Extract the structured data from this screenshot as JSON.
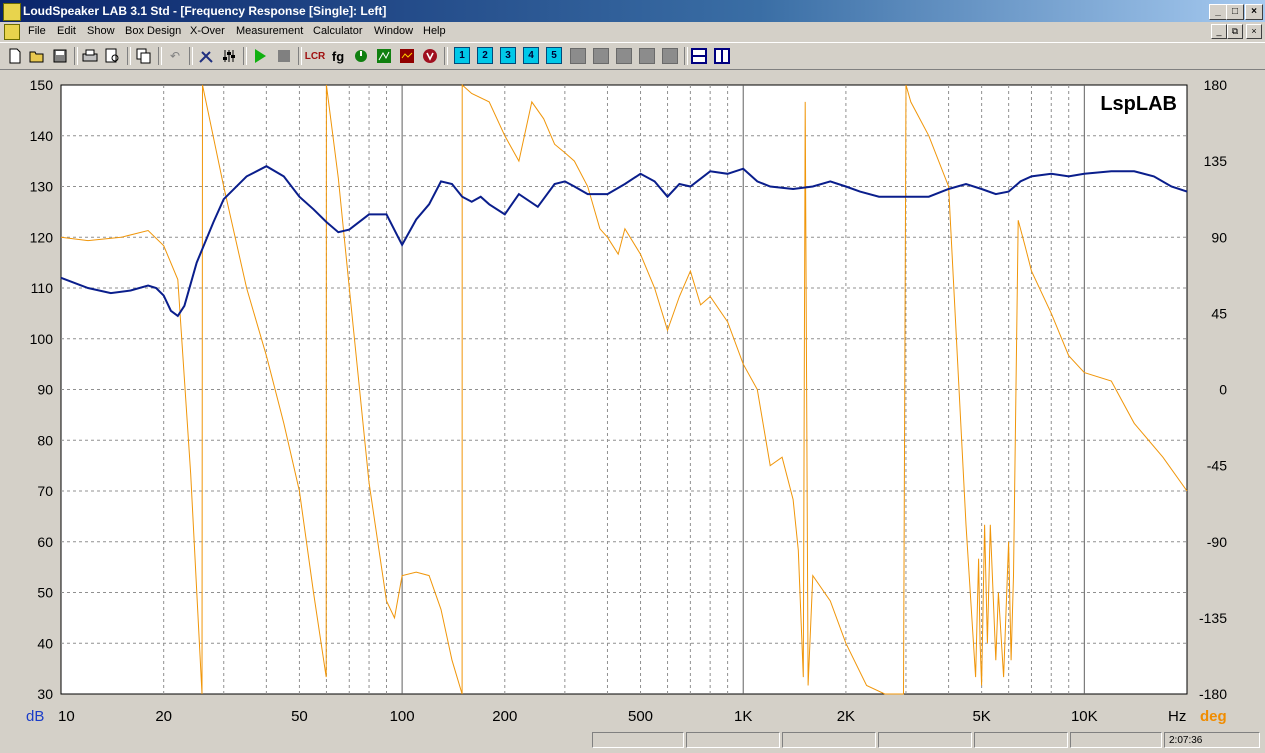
{
  "window": {
    "title": "LoudSpeaker LAB 3.1 Std - [Frequency Response [Single]: Left]",
    "controls": [
      "_",
      "□",
      "×"
    ],
    "mdi_controls": [
      "_",
      "⧉",
      "×"
    ]
  },
  "menu": [
    "File",
    "Edit",
    "Show",
    "Box Design",
    "X-Over",
    "Measurement",
    "Calculator",
    "Window",
    "Help"
  ],
  "toolbar": {
    "numbered_buttons": [
      "1",
      "2",
      "3",
      "4",
      "5"
    ],
    "icons": [
      "new-icon",
      "open-icon",
      "save-icon",
      "print-icon",
      "print-preview-icon",
      "copy-icon",
      "undo-icon",
      "tools-icon",
      "sliders-icon",
      "play-icon",
      "stop-icon",
      "lcr-icon",
      "fg-icon",
      "gauge-icon",
      "chart-icon",
      "waterfall-icon",
      "v-icon",
      "split-h-icon",
      "split-v-icon"
    ],
    "lcr_label": "LCR",
    "fg_label": "fg"
  },
  "chart_data": {
    "type": "line",
    "watermark": "LspLAB",
    "xscale": "log",
    "xlim": [
      10,
      20000
    ],
    "x_ticks": [
      10,
      20,
      50,
      100,
      200,
      500,
      1000,
      2000,
      5000,
      10000
    ],
    "x_tick_labels": [
      "10",
      "20",
      "50",
      "100",
      "200",
      "500",
      "1K",
      "2K",
      "5K",
      "10K"
    ],
    "x_unit": "Hz",
    "y_left": {
      "unit": "dB",
      "lim": [
        30,
        150
      ],
      "ticks": [
        30,
        40,
        50,
        60,
        70,
        80,
        90,
        100,
        110,
        120,
        130,
        140,
        150
      ]
    },
    "y_right": {
      "unit": "deg",
      "lim": [
        -180,
        180
      ],
      "ticks": [
        180,
        135,
        90,
        45,
        0,
        -45,
        -90,
        -135,
        -180
      ]
    },
    "grid": true,
    "colors": {
      "magnitude": "#0a1e8c",
      "phase": "#f0960a",
      "left_unit": "#1a3cc8",
      "right_unit": "#f08c00"
    },
    "series": [
      {
        "axis": "left",
        "x": [
          10,
          12,
          14,
          16,
          18,
          19,
          20,
          21,
          22,
          23,
          25,
          28,
          30,
          35,
          40,
          45,
          50,
          55,
          60,
          65,
          70,
          80,
          90,
          100,
          110,
          120,
          130,
          140,
          150,
          160,
          170,
          180,
          200,
          220,
          250,
          280,
          300,
          320,
          350,
          400,
          450,
          500,
          550,
          600,
          650,
          700,
          800,
          900,
          1000,
          1100,
          1200,
          1400,
          1600,
          1800,
          2000,
          2200,
          2500,
          3000,
          3500,
          4000,
          4500,
          5000,
          5500,
          6000,
          6500,
          7000,
          8000,
          9000,
          10000,
          12000,
          14000,
          16000,
          18000,
          20000
        ],
        "values": [
          112,
          110,
          109,
          109.5,
          110.5,
          110,
          108.5,
          105.5,
          104.5,
          106.5,
          115,
          123,
          127.5,
          132,
          134,
          132,
          128,
          125.5,
          123,
          121,
          121.5,
          124.5,
          124.5,
          118.5,
          123.5,
          126.5,
          131,
          130.5,
          128,
          127,
          128,
          126.5,
          124.5,
          128.5,
          126,
          130.5,
          131,
          130,
          128.5,
          128.5,
          130.5,
          132.5,
          131,
          128,
          130.5,
          130,
          133,
          132.5,
          133.5,
          131,
          130,
          129.5,
          130,
          131,
          130,
          129,
          128,
          128,
          128,
          129.5,
          130.5,
          129.5,
          128.5,
          129,
          131,
          132,
          132.5,
          132,
          132.5,
          133,
          133,
          132,
          130,
          129
        ]
      },
      {
        "axis": "right",
        "x": [
          10,
          12,
          15,
          18,
          20,
          22,
          24,
          25.9,
          26,
          30,
          35,
          40,
          45,
          50,
          55,
          59.9,
          60,
          65,
          70,
          80,
          90,
          95,
          100,
          110,
          120,
          130,
          140,
          149.9,
          150,
          160,
          180,
          200,
          220,
          240,
          260,
          280,
          300,
          320,
          350,
          380,
          400,
          430,
          450,
          500,
          550,
          600,
          650,
          700,
          750,
          800,
          900,
          1000,
          1100,
          1200,
          1300,
          1400,
          1450,
          1500,
          1520,
          1550,
          1600,
          1800,
          2000,
          2300,
          2600,
          2950,
          3000,
          3100,
          3500,
          4000,
          4500,
          4800,
          4900,
          4950,
          5000,
          5100,
          5200,
          5300,
          5500,
          5600,
          5800,
          6000,
          6100,
          6200,
          6400,
          6700,
          7000,
          8000,
          9000,
          10000,
          12000,
          14000,
          17000,
          20000
        ],
        "values": [
          90,
          88,
          90,
          94,
          85,
          65,
          -50,
          -180,
          180,
          120,
          60,
          20,
          -20,
          -60,
          -120,
          -170,
          180,
          125,
          60,
          -55,
          -125,
          -135,
          -110,
          -108,
          -110,
          -130,
          -160,
          -180,
          180,
          175,
          170,
          150,
          135,
          170,
          160,
          145,
          140,
          135,
          120,
          95,
          90,
          80,
          95,
          80,
          60,
          35,
          55,
          70,
          50,
          55,
          40,
          15,
          0,
          -45,
          -40,
          -65,
          -95,
          -170,
          170,
          -175,
          -110,
          -125,
          -150,
          -175,
          -180,
          -180,
          180,
          170,
          150,
          120,
          -80,
          -170,
          -100,
          -150,
          -175,
          -80,
          -150,
          -80,
          -160,
          -120,
          -170,
          -90,
          -160,
          -110,
          100,
          85,
          70,
          45,
          20,
          10,
          5,
          -20,
          -40,
          -60
        ]
      }
    ]
  },
  "status": {
    "time": "2:07:36"
  }
}
